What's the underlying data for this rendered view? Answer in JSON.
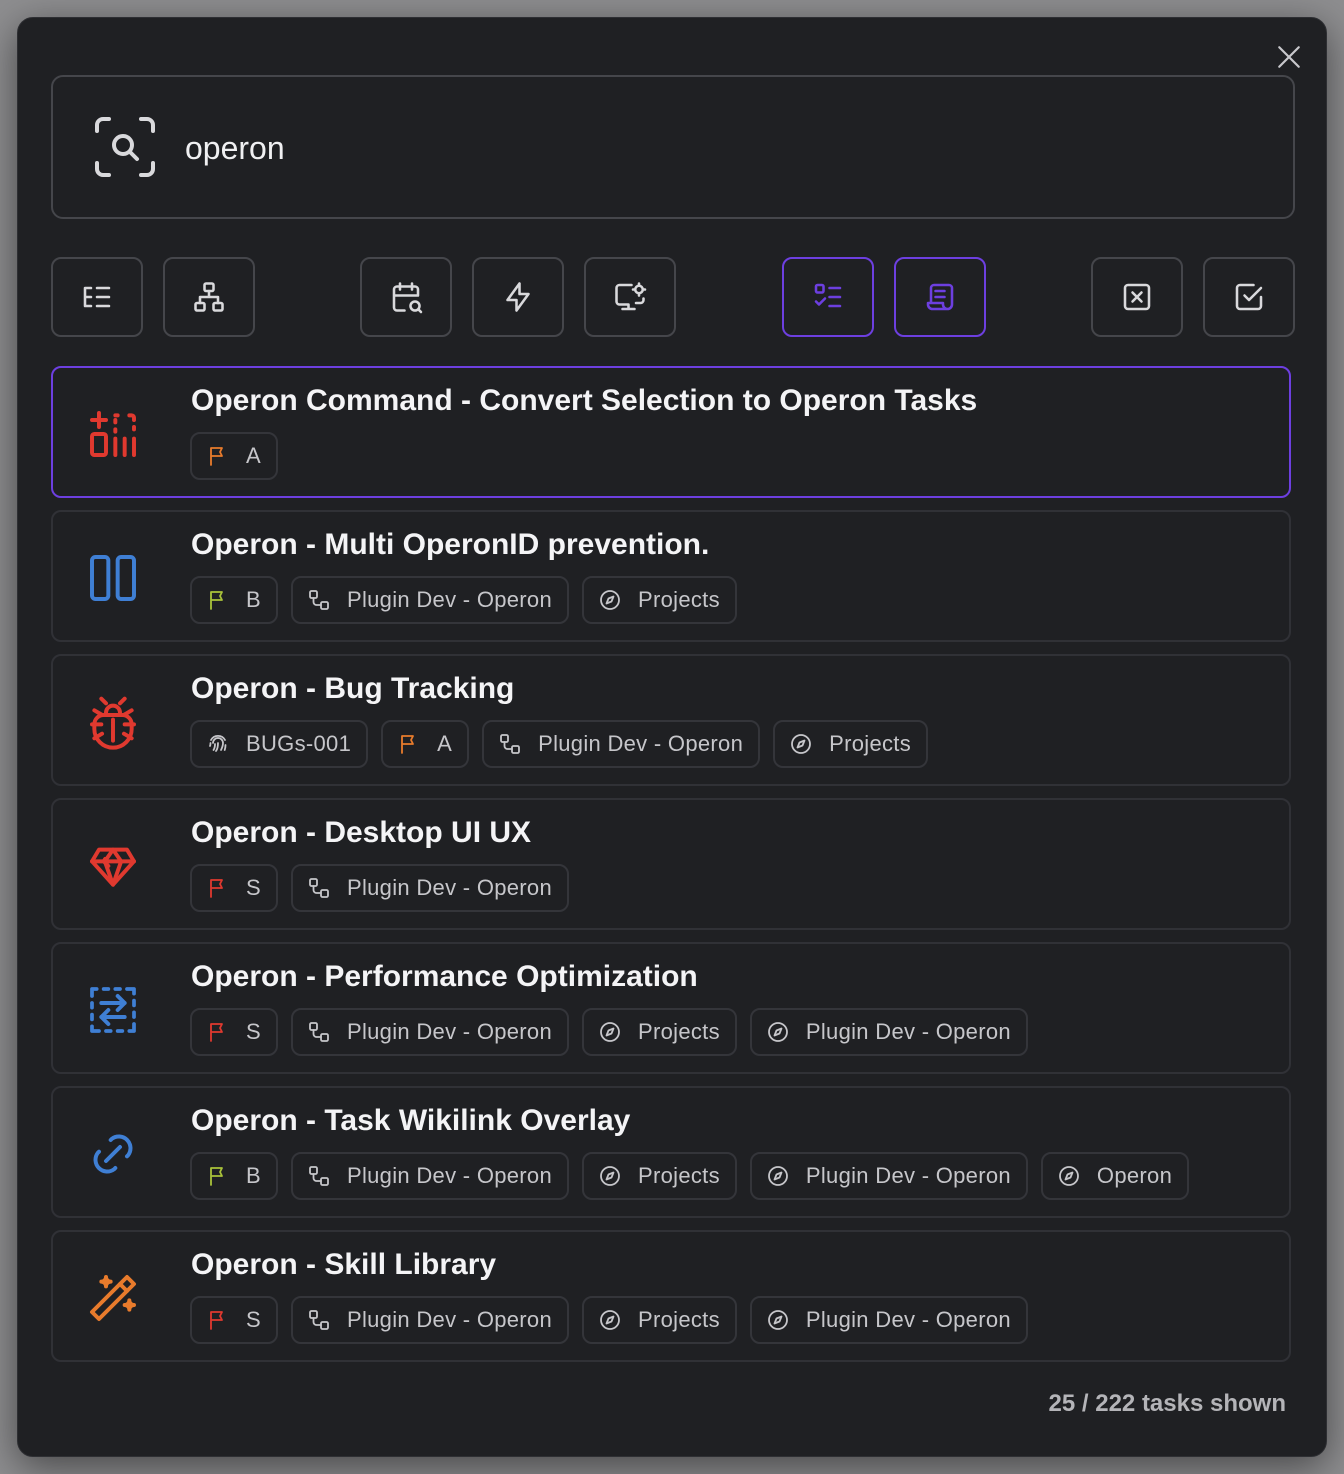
{
  "search": {
    "value": "operon"
  },
  "toolbar": [
    {
      "name": "list-tree-button",
      "icon": "list-tree-icon",
      "active": false
    },
    {
      "name": "hierarchy-button",
      "icon": "sitemap-icon",
      "active": false
    },
    {
      "name": "calendar-search-button",
      "icon": "calendar-search-icon",
      "active": false
    },
    {
      "name": "bolt-button",
      "icon": "bolt-icon",
      "active": false
    },
    {
      "name": "monitor-settings-button",
      "icon": "monitor-cog-icon",
      "active": false
    },
    {
      "name": "task-list-button",
      "icon": "list-check-icon",
      "active": true
    },
    {
      "name": "scroll-button",
      "icon": "scroll-icon",
      "active": true
    },
    {
      "name": "uncheck-all-button",
      "icon": "square-x-icon",
      "active": false
    },
    {
      "name": "check-all-button",
      "icon": "square-check-icon",
      "active": false
    }
  ],
  "tasks": [
    {
      "title": "Operon Command - Convert Selection to Operon Tasks",
      "icon": "transform-icon",
      "icon_color": "#e0392f",
      "chips": [
        {
          "icon": "flag-icon",
          "color": "#e87b2c",
          "label": "A"
        }
      ]
    },
    {
      "title": "Operon - Multi OperonID prevention.",
      "icon": "columns-icon",
      "icon_color": "#3f7fd4",
      "chips": [
        {
          "icon": "flag-icon",
          "color": "#a9c23a",
          "label": "B"
        },
        {
          "icon": "hierarchy-icon",
          "color": "#c6c6ca",
          "label": "Plugin Dev - Operon"
        },
        {
          "icon": "compass-icon",
          "color": "#c6c6ca",
          "label": "Projects"
        }
      ]
    },
    {
      "title": "Operon - Bug Tracking",
      "icon": "bug-icon",
      "icon_color": "#e0392f",
      "chips": [
        {
          "icon": "fingerprint-icon",
          "color": "#c6c6ca",
          "label": "BUGs-001"
        },
        {
          "icon": "flag-icon",
          "color": "#e87b2c",
          "label": "A"
        },
        {
          "icon": "hierarchy-icon",
          "color": "#c6c6ca",
          "label": "Plugin Dev - Operon"
        },
        {
          "icon": "compass-icon",
          "color": "#c6c6ca",
          "label": "Projects"
        }
      ]
    },
    {
      "title": "Operon - Desktop UI UX",
      "icon": "diamond-icon",
      "icon_color": "#e0392f",
      "chips": [
        {
          "icon": "flag-icon",
          "color": "#e0392f",
          "label": "S"
        },
        {
          "icon": "hierarchy-icon",
          "color": "#c6c6ca",
          "label": "Plugin Dev - Operon"
        }
      ]
    },
    {
      "title": "Operon - Performance Optimization",
      "icon": "switch-arrows-icon",
      "icon_color": "#3f7fd4",
      "chips": [
        {
          "icon": "flag-icon",
          "color": "#e0392f",
          "label": "S"
        },
        {
          "icon": "hierarchy-icon",
          "color": "#c6c6ca",
          "label": "Plugin Dev - Operon"
        },
        {
          "icon": "compass-icon",
          "color": "#c6c6ca",
          "label": "Projects"
        },
        {
          "icon": "compass-icon",
          "color": "#c6c6ca",
          "label": "Plugin Dev - Operon"
        }
      ]
    },
    {
      "title": "Operon - Task Wikilink Overlay",
      "icon": "link-icon",
      "icon_color": "#3f7fd4",
      "chips": [
        {
          "icon": "flag-icon",
          "color": "#a9c23a",
          "label": "B"
        },
        {
          "icon": "hierarchy-icon",
          "color": "#c6c6ca",
          "label": "Plugin Dev - Operon"
        },
        {
          "icon": "compass-icon",
          "color": "#c6c6ca",
          "label": "Projects"
        },
        {
          "icon": "compass-icon",
          "color": "#c6c6ca",
          "label": "Plugin Dev - Operon"
        },
        {
          "icon": "compass-icon",
          "color": "#c6c6ca",
          "label": "Operon"
        }
      ]
    },
    {
      "title": "Operon - Skill Library",
      "icon": "magic-wand-icon",
      "icon_color": "#e87b2c",
      "chips": [
        {
          "icon": "flag-icon",
          "color": "#e0392f",
          "label": "S"
        },
        {
          "icon": "hierarchy-icon",
          "color": "#c6c6ca",
          "label": "Plugin Dev - Operon"
        },
        {
          "icon": "compass-icon",
          "color": "#c6c6ca",
          "label": "Projects"
        },
        {
          "icon": "compass-icon",
          "color": "#c6c6ca",
          "label": "Plugin Dev - Operon"
        }
      ]
    }
  ],
  "footer": {
    "count_text": "25 / 222 tasks shown"
  },
  "colors": {
    "accent": "#6d3fe0",
    "background": "#1f2023",
    "border": "#45464b"
  }
}
